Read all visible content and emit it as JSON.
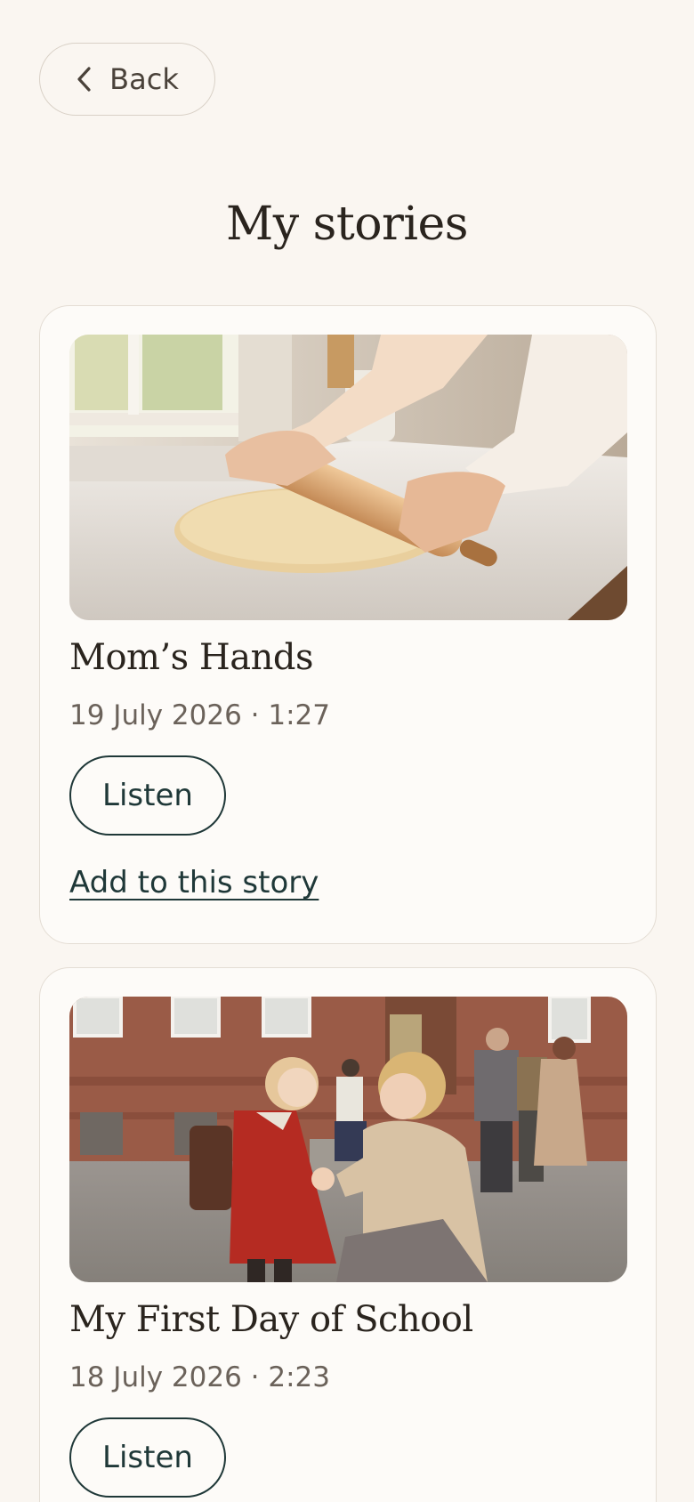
{
  "header": {
    "back_label": "Back",
    "back_icon": "chevron-left-icon",
    "title": "My stories"
  },
  "stories": [
    {
      "title": "Mom’s Hands",
      "meta": "19 July 2026 · 1:27",
      "listen_label": "Listen",
      "add_label": "Add to this story",
      "image": "photo of hands rolling dough with a rolling pin on a marble counter"
    },
    {
      "title": "My First Day of School",
      "meta": "18 July 2026 · 2:23",
      "listen_label": "Listen",
      "image": "vintage photo of a mother kneeling to button a girl's red coat in front of a brick school"
    }
  ],
  "colors": {
    "background": "#faf6f1",
    "card": "#fdfbf8",
    "accent": "#1f3838",
    "muted_text": "#6b625a"
  }
}
